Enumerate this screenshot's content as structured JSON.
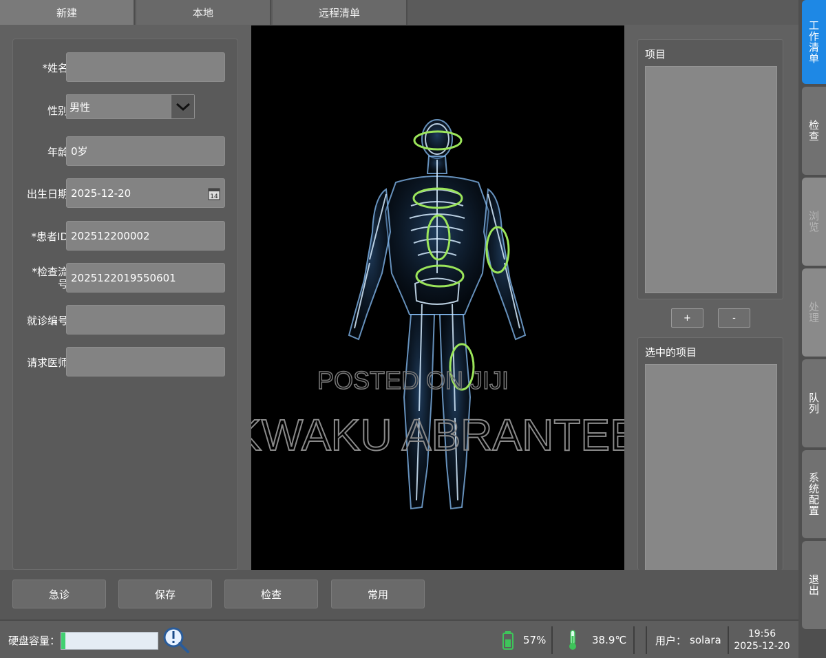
{
  "top_tabs": [
    {
      "label": "新建"
    },
    {
      "label": "本地"
    },
    {
      "label": "远程清单"
    }
  ],
  "form": {
    "name": {
      "label": "*姓名：",
      "value": ""
    },
    "gender": {
      "label": "性别：",
      "value": "男性"
    },
    "age": {
      "label": "年龄：",
      "value": "0岁"
    },
    "birth_date": {
      "label": "出生日期：",
      "value": "2025-12-20",
      "calendar_day": "14"
    },
    "patient_id": {
      "label": "*患者ID：",
      "value": "202512200002"
    },
    "exam_serial": {
      "label": "*检查流水号：",
      "value": "2025122019550601"
    },
    "visit_no": {
      "label": "就诊编号：",
      "value": ""
    },
    "doctor": {
      "label": "请求医师：",
      "value": ""
    }
  },
  "watermark": {
    "line1": "POSTED ON JIJI",
    "line2": "KWAKU ABRANTEE"
  },
  "items_panel": {
    "title": "项目",
    "add_label": "+",
    "remove_label": "-"
  },
  "selected_panel": {
    "title": "选中的项目"
  },
  "side_nav": [
    {
      "label": "工作清单"
    },
    {
      "label": "检查"
    },
    {
      "label": "浏览"
    },
    {
      "label": "处理"
    },
    {
      "label": "队列"
    },
    {
      "label": "系统配置"
    },
    {
      "label": "退出"
    }
  ],
  "actions": [
    {
      "label": "急诊"
    },
    {
      "label": "保存"
    },
    {
      "label": "检查"
    },
    {
      "label": "常用"
    }
  ],
  "status": {
    "disk_label": "硬盘容量：",
    "disk_fill_fraction": 0.04,
    "battery": "57%",
    "temperature": "38.9℃",
    "user_label": "用户：",
    "user": "solara",
    "time": "19:56",
    "date": "2025-12-20"
  },
  "colors": {
    "accent": "#1e88e5",
    "battery": "#3ec45a",
    "highlight_ring": "#9be55a"
  }
}
